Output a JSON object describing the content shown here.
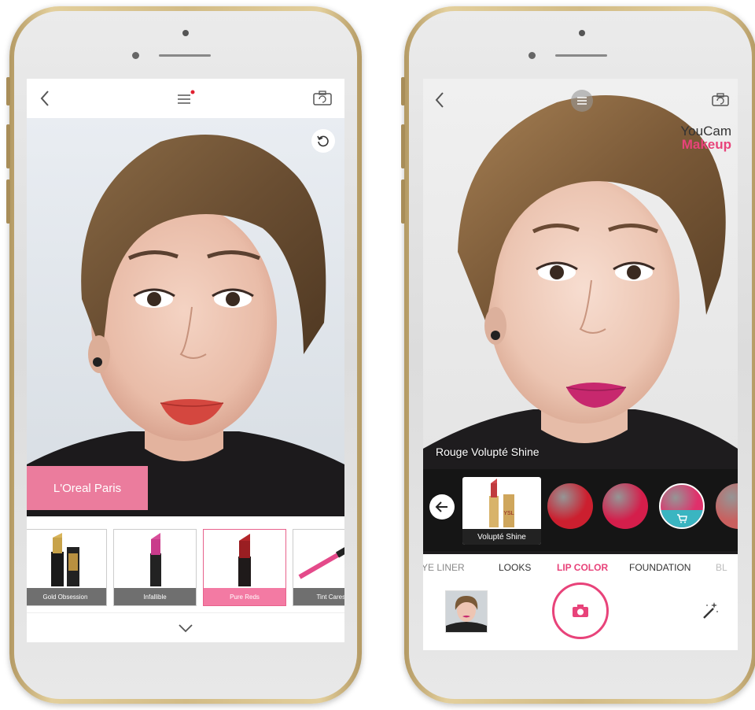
{
  "left_app": {
    "brand_tag": "L'Oreal Paris",
    "products": [
      {
        "label": "Gold Obsession",
        "selected": false
      },
      {
        "label": "Infallible",
        "selected": false
      },
      {
        "label": "Pure Reds",
        "selected": true
      },
      {
        "label": "Tint Caresse",
        "selected": false
      }
    ],
    "icons": {
      "back": "back-chevron-icon",
      "menu": "menu-icon",
      "camera_switch": "camera-switch-icon",
      "reset": "reset-icon",
      "collapse": "chevron-down-icon"
    }
  },
  "right_app": {
    "logo_line1": "YouCam",
    "logo_line2": "Makeup",
    "product_name": "Rouge Volupté Shine",
    "product_card_label": "Volupté Shine",
    "swatches": [
      {
        "color": "#cc1f2f"
      },
      {
        "color": "#d41e4b"
      },
      {
        "color": "#e0306b",
        "selected": true
      },
      {
        "color": "#c9605f"
      }
    ],
    "tabs": [
      {
        "label": "YE LINER",
        "active": false
      },
      {
        "label": "LOOKS",
        "active": false
      },
      {
        "label": "LIP COLOR",
        "active": true
      },
      {
        "label": "FOUNDATION",
        "active": false
      },
      {
        "label": "BL",
        "active": false
      }
    ],
    "icons": {
      "back": "back-chevron-icon",
      "menu": "menu-icon",
      "camera_switch": "camera-switch-icon",
      "swatch_back": "arrow-left-icon",
      "capture": "camera-icon",
      "magic": "magic-wand-icon",
      "cart": "cart-icon"
    }
  },
  "colors": {
    "accent_pink": "#e8437a",
    "tag_pink": "#eb7c9d",
    "gold_frame": "#d6bf8a"
  }
}
